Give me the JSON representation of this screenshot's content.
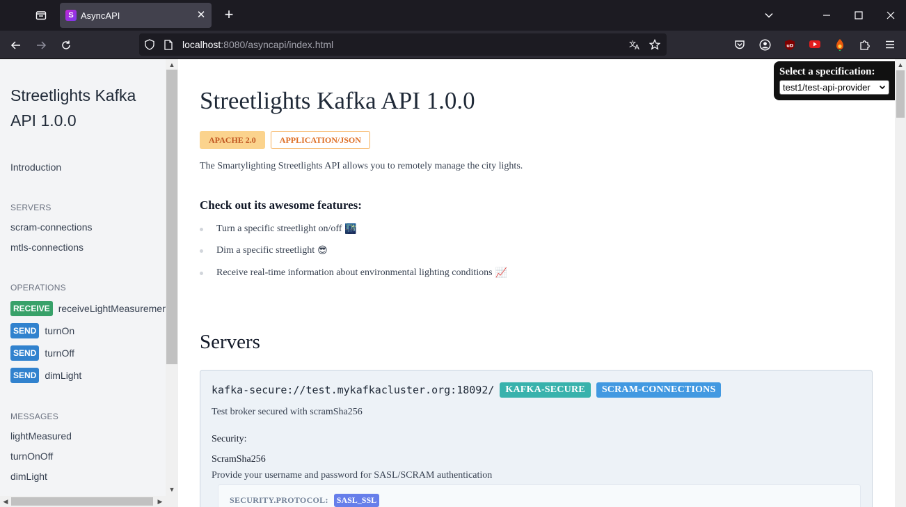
{
  "browser": {
    "tab_title": "AsyncAPI",
    "tab_favicon_letter": "S",
    "url_host": "localhost",
    "url_rest": ":8080/asyncapi/index.html"
  },
  "sidebar": {
    "title": "Streetlights Kafka API 1.0.0",
    "introduction": "Introduction",
    "servers_heading": "SERVERS",
    "servers": [
      "scram-connections",
      "mtls-connections"
    ],
    "operations_heading": "OPERATIONS",
    "operations": [
      {
        "badge": "RECEIVE",
        "name": "receiveLightMeasurement"
      },
      {
        "badge": "SEND",
        "name": "turnOn"
      },
      {
        "badge": "SEND",
        "name": "turnOff"
      },
      {
        "badge": "SEND",
        "name": "dimLight"
      }
    ],
    "messages_heading": "MESSAGES",
    "messages": [
      "lightMeasured",
      "turnOnOff",
      "dimLight"
    ]
  },
  "spec_selector": {
    "label": "Select a specification:",
    "selected": "test1/test-api-provider"
  },
  "main": {
    "title": "Streetlights Kafka API 1.0.0",
    "badges": [
      "APACHE 2.0",
      "APPLICATION/JSON"
    ],
    "description": "The Smartylighting Streetlights API allows you to remotely manage the city lights.",
    "features_heading": "Check out its awesome features:",
    "features": [
      {
        "text": "Turn a specific streetlight on/off",
        "emoji": "🌃"
      },
      {
        "text": "Dim a specific streetlight",
        "emoji": "😎"
      },
      {
        "text": "Receive real-time information about environmental lighting conditions",
        "emoji": "📈"
      }
    ],
    "servers_heading": "Servers",
    "server": {
      "url": "kafka-secure://test.mykafkacluster.org:18092/",
      "badges": [
        "KAFKA-SECURE",
        "SCRAM-CONNECTIONS"
      ],
      "description": "Test broker secured with scramSha256",
      "security_label": "Security:",
      "security_name": "ScramSha256",
      "security_description": "Provide your username and password for SASL/SCRAM authentication",
      "security_protocol_label": "SECURITY.PROTOCOL:",
      "security_protocol_value": "SASL_SSL"
    }
  }
}
